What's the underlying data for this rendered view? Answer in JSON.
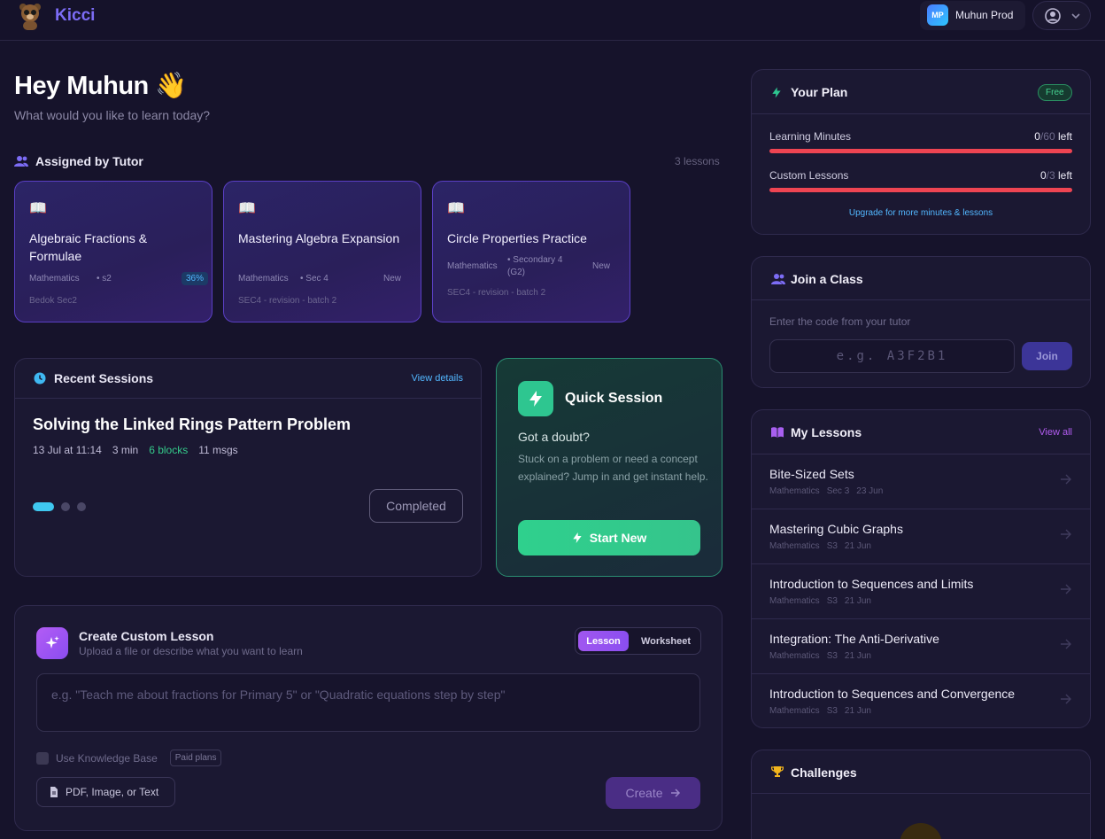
{
  "brand": {
    "name": "Kicci"
  },
  "user": {
    "initials": "MP",
    "name": "Muhun Prod"
  },
  "greeting": {
    "title": "Hey Muhun 👋",
    "subtitle": "What would you like to learn today?"
  },
  "assigned": {
    "title": "Assigned by Tutor",
    "count_label": "3 lessons",
    "cards": [
      {
        "title": "Algebraic Fractions & Formulae",
        "subject": "Mathematics",
        "level": "• s2",
        "tag": "36%",
        "batch": "Bedok Sec2"
      },
      {
        "title": "Mastering Algebra Expansion",
        "subject": "Mathematics",
        "level": "• Sec 4",
        "tag": "New",
        "batch": "SEC4 - revision - batch 2"
      },
      {
        "title": "Circle Properties Practice",
        "subject": "Mathematics",
        "level": "• Secondary 4 (G2)",
        "tag": "New",
        "batch": "SEC4 - revision - batch 2"
      }
    ]
  },
  "recent": {
    "title": "Recent Sessions",
    "view_details": "View details",
    "session_title": "Solving the Linked Rings Pattern Problem",
    "date": "13 Jul at 11:14",
    "duration": "3 min",
    "blocks": "6 blocks",
    "msgs": "11 msgs",
    "status": "Completed"
  },
  "quick": {
    "title": "Quick Session",
    "subtitle": "Got a doubt?",
    "description": "Stuck on a problem or need a concept explained? Jump in and get instant help.",
    "button": "Start New"
  },
  "create": {
    "title": "Create Custom Lesson",
    "subtitle": "Upload a file or describe what you want to learn",
    "toggle_lesson": "Lesson",
    "toggle_worksheet": "Worksheet",
    "placeholder": "e.g. \"Teach me about fractions for Primary 5\" or \"Quadratic equations step by step\"",
    "kb_label": "Use Knowledge Base",
    "paid_tag": "Paid plans",
    "upload_label": "PDF, Image, or Text",
    "create_label": "Create"
  },
  "plan": {
    "title": "Your Plan",
    "badge": "Free",
    "rows": [
      {
        "label": "Learning Minutes",
        "used": "0",
        "total": "/60",
        "suffix": " left",
        "usage_fraction": 0
      },
      {
        "label": "Custom Lessons",
        "used": "0",
        "total": "/3",
        "suffix": " left",
        "usage_fraction": 0
      }
    ],
    "upgrade": "Upgrade for more minutes & lessons"
  },
  "join": {
    "title": "Join a Class",
    "help": "Enter the code from your tutor",
    "placeholder": "e.g. A3F2B1",
    "button": "Join"
  },
  "lessons": {
    "title": "My Lessons",
    "view_all": "View all",
    "items": [
      {
        "title": "Bite-Sized Sets",
        "subject": "Mathematics",
        "level": "Sec 3",
        "date": "23 Jun"
      },
      {
        "title": "Mastering Cubic Graphs",
        "subject": "Mathematics",
        "level": "S3",
        "date": "21 Jun"
      },
      {
        "title": "Introduction to Sequences and Limits",
        "subject": "Mathematics",
        "level": "S3",
        "date": "21 Jun"
      },
      {
        "title": "Integration: The Anti-Derivative",
        "subject": "Mathematics",
        "level": "S3",
        "date": "21 Jun"
      },
      {
        "title": "Introduction to Sequences and Convergence",
        "subject": "Mathematics",
        "level": "S3",
        "date": "21 Jun"
      }
    ]
  },
  "challenges": {
    "title": "Challenges"
  },
  "colors": {
    "accent": "#7c6cf5",
    "green": "#2ec690",
    "danger": "#ee4452",
    "link": "#52b7ff"
  },
  "icons": [
    "mascot-icon",
    "user-circle-icon",
    "chevron-down-icon",
    "users-icon",
    "book-icon",
    "clock-icon",
    "bolt-icon",
    "sparkle-icon",
    "file-icon",
    "arrow-right-icon",
    "trophy-icon",
    "lessons-icon"
  ]
}
